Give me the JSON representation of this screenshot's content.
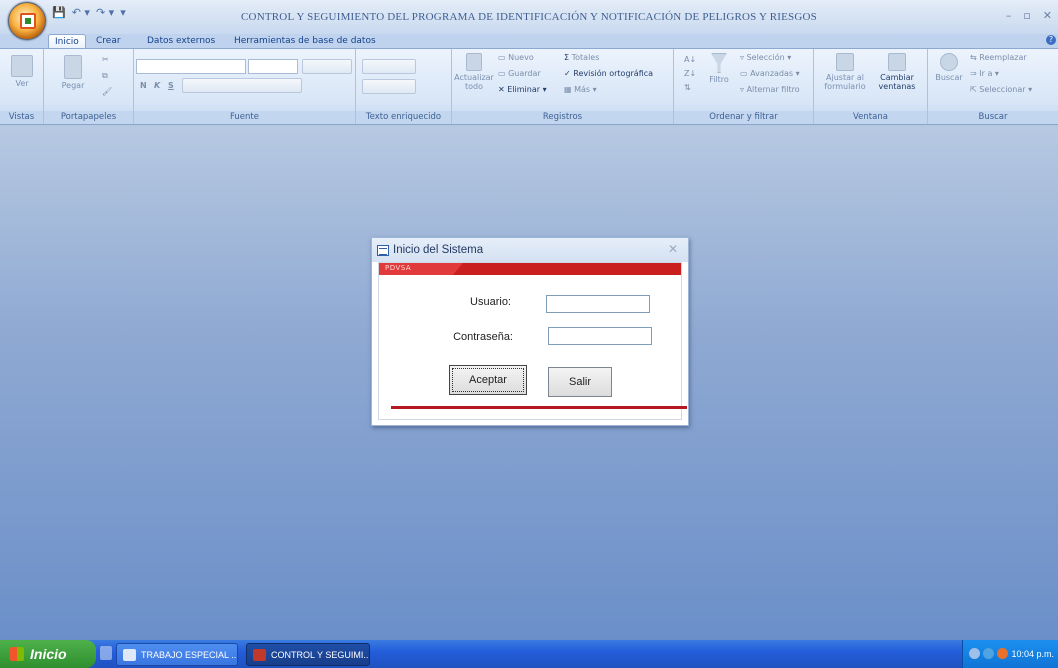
{
  "window": {
    "title": "CONTROL Y SEGUIMIENTO DEL PROGRAMA DE IDENTIFICACIÓN Y NOTIFICACIÓN DE PELIGROS Y RIESGOS",
    "controls": [
      "–",
      "▫",
      "✕"
    ]
  },
  "tabs": [
    "Inicio",
    "Crear",
    "Datos externos",
    "Herramientas de base de datos"
  ],
  "active_tab": "Inicio",
  "ribbon": {
    "vistas": {
      "label": "Vistas",
      "ver": "Ver"
    },
    "portapapeles": {
      "label": "Portapapeles",
      "pegar": "Pegar"
    },
    "fuente": {
      "label": "Fuente",
      "bold": "N",
      "italic": "K",
      "underline": "S"
    },
    "texto": {
      "label": "Texto enriquecido"
    },
    "registros": {
      "label": "Registros",
      "actualizar": "Actualizar",
      "todo": "todo",
      "nuevo": "Nuevo",
      "guardar": "Guardar",
      "eliminar": "Eliminar",
      "totales": "Totales",
      "revision": "Revisión ortográfica",
      "mas": "Más"
    },
    "ordenar": {
      "label": "Ordenar y filtrar",
      "filtro": "Filtro",
      "seleccion": "Selección",
      "avanzadas": "Avanzadas",
      "alternar": "Alternar filtro"
    },
    "ventana": {
      "label": "Ventana",
      "ajustar": "Ajustar al",
      "formulario": "formulario",
      "cambiar": "Cambiar",
      "ventanas": "ventanas"
    },
    "buscar": {
      "label": "Buscar",
      "buscar": "Buscar",
      "reemplazar": "Reemplazar",
      "ira": "Ir a",
      "seleccionar": "Seleccionar"
    }
  },
  "dialog": {
    "title": "Inicio del Sistema",
    "brand": "PDVSA",
    "usuario_label": "Usuario:",
    "usuario_value": "",
    "password_label": "Contraseña:",
    "password_value": "",
    "aceptar": "Aceptar",
    "salir": "Salir"
  },
  "taskbar": {
    "start": "Inicio",
    "tasks": [
      "TRABAJO ESPECIAL ...",
      "CONTROL Y SEGUIMI..."
    ],
    "clock": "10:04 p.m."
  },
  "colors": {
    "accent_red": "#c91f1f",
    "workspace_blue": "#6b8fc9",
    "taskbar_blue": "#245edb"
  }
}
